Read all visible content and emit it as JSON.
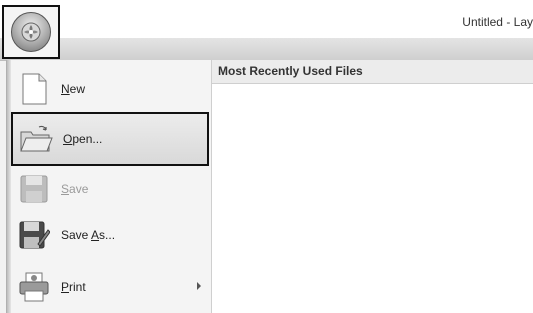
{
  "window": {
    "title": "Untitled - Lay"
  },
  "app_button": {
    "icon": "app-orb-icon"
  },
  "menu": {
    "items": [
      {
        "pre": "",
        "mnemonic": "N",
        "post": "ew",
        "icon": "new-document-icon",
        "enabled": true,
        "selected": false
      },
      {
        "pre": "",
        "mnemonic": "O",
        "post": "pen...",
        "icon": "open-folder-icon",
        "enabled": true,
        "selected": true
      },
      {
        "pre": "",
        "mnemonic": "S",
        "post": "ave",
        "icon": "save-icon",
        "enabled": false,
        "selected": false
      },
      {
        "pre": "Save ",
        "mnemonic": "A",
        "post": "s...",
        "icon": "save-as-icon",
        "enabled": true,
        "selected": false
      },
      {
        "pre": "",
        "mnemonic": "P",
        "post": "rint",
        "icon": "print-icon",
        "enabled": true,
        "selected": false,
        "has_submenu": true
      }
    ]
  },
  "recent_files": {
    "header": "Most Recently Used Files"
  }
}
